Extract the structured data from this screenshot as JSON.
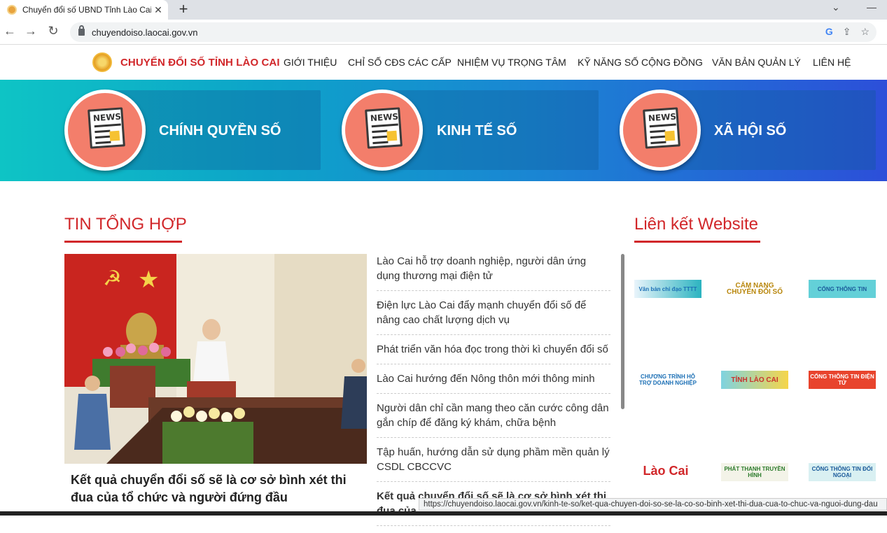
{
  "browser": {
    "tab_title": "Chuyển đổi số UBND Tỉnh Lào Cai",
    "new_tab": "+",
    "url": "chuyendoiso.laocai.gov.vn",
    "status_url": "https://chuyendoiso.laocai.gov.vn/kinh-te-so/ket-qua-chuyen-doi-so-se-la-co-so-binh-xet-thi-dua-cua-to-chuc-va-nguoi-dung-dau"
  },
  "header": {
    "brand": "CHUYỂN ĐỔI SỐ TỈNH LÀO CAI",
    "nav": [
      "GIỚI THIỆU",
      "CHỈ SỐ CĐS CÁC CẤP",
      "NHIỆM VỤ TRỌNG TÂM",
      "KỸ NĂNG SỐ CỘNG ĐỒNG",
      "VĂN BẢN QUẢN LÝ",
      "LIÊN HỆ"
    ]
  },
  "banner": {
    "cards": [
      {
        "icon_text": "NEWS",
        "label": "CHÍNH QUYỀN SỐ"
      },
      {
        "icon_text": "NEWS",
        "label": "KINH TẾ SỐ"
      },
      {
        "icon_text": "NEWS",
        "label": "XÃ HỘI SỐ"
      }
    ]
  },
  "news": {
    "section_title": "TIN TỔNG HỢP",
    "feature_title": "Kết quả chuyển đổi số sẽ là cơ sở bình xét thi đua của tổ chức và người đứng đầu",
    "items": [
      "Lào Cai hỗ trợ doanh nghiệp, người dân ứng dụng thương mại điện tử",
      "Điện lực Lào Cai đẩy mạnh chuyển đổi số để nâng cao chất lượng dịch vụ",
      "Phát triển văn hóa đọc trong thời kì chuyển đổi số",
      "Lào Cai hướng đến Nông thôn mới thông minh",
      "Người dân chỉ cần mang theo căn cước công dân gắn chíp để đăng ký khám, chữa bệnh",
      "Tập huấn, hướng dẫn sử dụng phầm mền quản lý CSDL CBCCVC",
      "Kết quả chuyển đổi số sẽ là cơ sở bình xét thi đua của"
    ]
  },
  "links": {
    "section_title": "Liên kết Website",
    "logos": [
      {
        "text": "Văn bản chỉ đạo TTTT",
        "color": "#1b6fb5"
      },
      {
        "text": "CẨM NANG CHUYỂN ĐỔI SỐ",
        "color": "#b8860b"
      },
      {
        "text": "CỔNG THÔNG TIN",
        "color": "#1a5a9a"
      },
      {
        "text": "CHƯƠNG TRÌNH HỖ TRỢ DOANH NGHIỆP",
        "color": "#1b6fb5"
      },
      {
        "text": "TỈNH LÀO CAI",
        "color": "#c9302c"
      },
      {
        "text": "CỔNG THÔNG TIN ĐIỆN TỬ",
        "color": "#ffffff"
      },
      {
        "text": "Lào Cai",
        "color": "#d1272a"
      },
      {
        "text": "PHÁT THANH TRUYỀN HÌNH",
        "color": "#2a7a2a"
      },
      {
        "text": "CỔNG THÔNG TIN ĐỐI NGOẠI",
        "color": "#1a5a9a"
      }
    ]
  }
}
